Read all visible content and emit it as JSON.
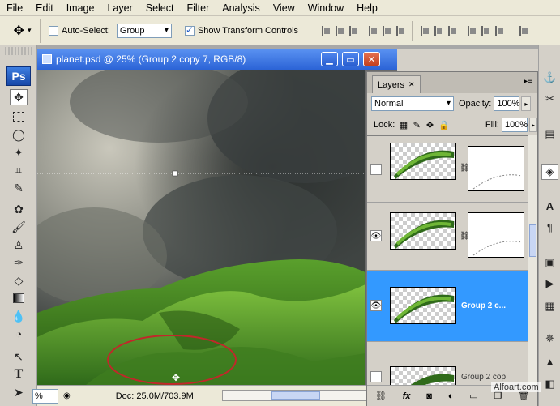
{
  "menu": [
    "File",
    "Edit",
    "Image",
    "Layer",
    "Select",
    "Filter",
    "Analysis",
    "View",
    "Window",
    "Help"
  ],
  "options": {
    "tool_icon": "move-icon",
    "auto_select_label": "Auto-Select:",
    "auto_select_checked": false,
    "auto_select_value": "Group",
    "transform_label": "Show Transform Controls",
    "transform_checked": true
  },
  "toolbox": {
    "logo": "Ps",
    "tools": [
      "move-tool",
      "marquee-tool",
      "lasso-tool",
      "magic-wand-tool",
      "crop-tool",
      "slice-tool",
      "healing-tool",
      "brush-tool",
      "stamp-tool",
      "history-brush-tool",
      "eraser-tool",
      "gradient-tool",
      "blur-tool",
      "dodge-tool",
      "path-selection-tool",
      "type-tool",
      "direct-selection-tool"
    ],
    "active": "move-tool"
  },
  "document": {
    "title": "planet.psd @ 25% (Group 2 copy 7, RGB/8)",
    "zoom": "%",
    "doc_size": "Doc: 25.0M/703.9M"
  },
  "layers": {
    "tab_label": "Layers",
    "blend_mode": "Normal",
    "opacity_label": "Opacity:",
    "opacity": "100%",
    "lock_label": "Lock:",
    "fill_label": "Fill:",
    "fill": "100%",
    "items": [
      {
        "name": "",
        "visible": false,
        "selected": false,
        "has_mask": true
      },
      {
        "name": "",
        "visible": true,
        "selected": false,
        "has_mask": true
      },
      {
        "name": "Group 2 c...",
        "visible": true,
        "selected": true,
        "has_mask": false
      },
      {
        "name": "Group 2 cop",
        "visible": false,
        "selected": false,
        "has_mask": false
      }
    ],
    "footer_icons": [
      "link-icon",
      "fx-icon",
      "mask-icon",
      "adjustment-icon",
      "group-icon",
      "new-layer-icon",
      "trash-icon"
    ]
  },
  "dock": [
    "navigator-icon",
    "tools-icon",
    "history-icon",
    "layers-icon",
    "character-icon",
    "paragraph-icon",
    "info-icon",
    "actions-icon",
    "swatches-icon",
    "styles-icon",
    "histogram-icon",
    "channels-icon"
  ],
  "watermark": "Alfoart.com"
}
